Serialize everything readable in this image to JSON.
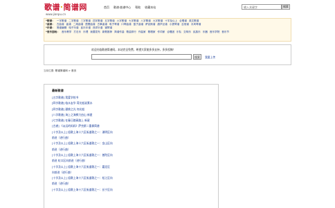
{
  "logo": {
    "main_a": "歌谱",
    "sep": "·",
    "main_b": "简谱网",
    "url": "www.jianpu.cn"
  },
  "topnav": [
    {
      "label": "首页"
    },
    {
      "label": "歌谱·曲谱中心"
    },
    {
      "label": "帮助"
    },
    {
      "label": "收藏本站"
    }
  ],
  "search": {
    "placeholder": "输入关键字",
    "button": "搜索"
  },
  "categories": [
    {
      "name": "*歌谱：",
      "items": [
        "一字歌谱",
        "二字歌谱",
        "三字歌谱",
        "四字歌谱",
        "五字歌谱",
        "六字歌谱",
        "七字歌谱",
        "八字歌谱",
        "九字歌谱",
        "十字及以上",
        "合唱谱",
        "英文歌谱"
      ]
    },
    {
      "name": "*曲谱：",
      "items": [
        "古曲谱",
        "曲谱",
        "二胡曲谱",
        "琵琶曲谱",
        "古筝曲谱",
        "电子琴谱",
        "口琴曲谱",
        "笛子曲谱",
        "萨克斯谱",
        "葫芦丝谱",
        "小提琴谱",
        "吉他谱",
        "手风琴谱"
      ]
    },
    {
      "name": "*乐谱：",
      "items": [
        "简谱编辑",
        "电子乐谱",
        "民乐乐谱",
        "西洋乐谱",
        "钢琴谱"
      ]
    },
    {
      "name": "*音乐园地：",
      "items": [
        "音乐教学",
        "打击乐",
        "乐理",
        "我要发布",
        "新歌推荐",
        "简谱作曲",
        "歌曲排行",
        "作曲家",
        "歌唱家",
        "作词家",
        "合唱团",
        "乐队",
        "交响乐",
        "民族乐",
        "乐器",
        "音乐学院",
        "音乐节"
      ]
    }
  ],
  "notice": {
    "text": "欢迎光临歌谱简谱网，本站完全免费，希望大家能多多支持，多多投稿！",
    "button": "搜索",
    "link": "我要上传"
  },
  "breadcrumb": {
    "label": "当前位置:",
    "path": "歌谱简谱网 > 首页"
  },
  "panel": {
    "title": "最新歌谱",
    "items": [
      "[五字歌谱] 我爱学校书",
      "[四字歌谱] 临水友华  荷光般淑素水",
      "[四字歌谱] 碧桃之光  何光般",
      "[八字歌谱] 海上之海狮力由山  新星",
      "[七字歌谱] 在春日踏青路上  新星",
      "[古谱] 《淡远的妈妈》萨克斯二重奏简谱",
      "[十字及以上] 组歌上海十六区街道歌之一：浦明区向",
      "前进（进行曲）",
      "[十字及以上] 组歌上海十六区街道歌之一：金山区向",
      "前进（进行曲）",
      "[十字及以上] 组歌上海十六区街道歌之一：普陀区向",
      "前进  虹口区向前进（进行曲）",
      "[十字及以上] 组歌上海十六区街道歌之一：嘉定区",
      "向前进（进行曲）",
      "[十字及以上] 组歌上海十六区街道歌之一：松江区向",
      "前进（进行曲）",
      "[十字及以上] 组歌上海十六区街道歌之一：长宁区向"
    ]
  }
}
